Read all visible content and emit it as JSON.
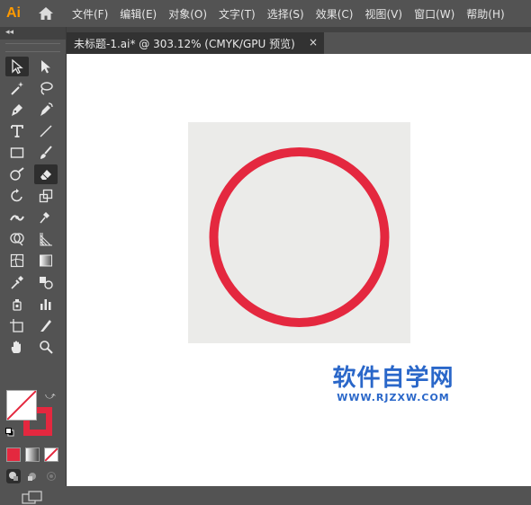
{
  "app": {
    "logo_text": "Ai"
  },
  "menu": [
    "文件(F)",
    "编辑(E)",
    "对象(O)",
    "文字(T)",
    "选择(S)",
    "效果(C)",
    "视图(V)",
    "窗口(W)",
    "帮助(H)"
  ],
  "document": {
    "tab_title": "未标题-1.ai* @ 303.12% (CMYK/GPU 预览)",
    "close_glyph": "×"
  },
  "colors": {
    "stroke": "#e4283f",
    "fill": "#ffffff",
    "artboard": "#ebebe9",
    "watermark": "#2a67c9"
  },
  "tools": [
    "selection-tool",
    "direct-selection-tool",
    "magic-wand-tool",
    "lasso-tool",
    "pen-tool",
    "curvature-tool",
    "type-tool",
    "line-segment-tool",
    "rectangle-tool",
    "paintbrush-tool",
    "shaper-tool",
    "eraser-tool",
    "rotate-tool",
    "scale-tool",
    "width-tool",
    "puppet-warp-tool",
    "shape-builder-tool",
    "perspective-grid-tool",
    "mesh-tool",
    "gradient-tool",
    "eyedropper-tool",
    "blend-tool",
    "symbol-sprayer-tool",
    "column-graph-tool",
    "artboard-tool",
    "slice-tool",
    "hand-tool",
    "zoom-tool"
  ],
  "selected_tool": "eraser-tool",
  "watermark": {
    "title": "软件自学网",
    "url": "WWW.RJZXW.COM"
  }
}
